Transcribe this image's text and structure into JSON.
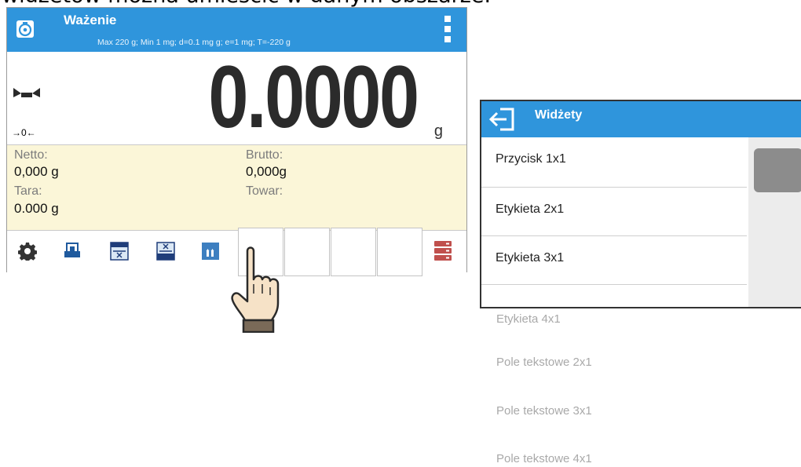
{
  "caption": "widżetów można umieścić w danym obszarze.",
  "scale": {
    "title": "Ważenie",
    "params": "Max 220 g; Min 1 mg; d=0.1 mg g; e=1 mg; T=-220 g",
    "zero_indicator": "→0←",
    "value": "0.0000",
    "unit": "g",
    "info": {
      "netto_label": "Netto:",
      "netto_value": "0,000 g",
      "brutto_label": "Brutto:",
      "brutto_value": "0,000g",
      "tara_label": "Tara:",
      "tara_value": "0.000 g",
      "towar_label": "Towar:"
    },
    "toolbar_icons": [
      "gear-icon",
      "print-icon",
      "tare-icon",
      "cancel-tare-icon",
      "stats-icon",
      "database-icon"
    ]
  },
  "widgets": {
    "title": "Widżety",
    "items": [
      "Przycisk 1x1",
      "Etykieta 2x1",
      "Etykieta 3x1"
    ],
    "more_items": [
      "Etykieta 4x1",
      "Pole tekstowe 2x1",
      "Pole tekstowe 3x1",
      "Pole tekstowe 4x1"
    ]
  }
}
